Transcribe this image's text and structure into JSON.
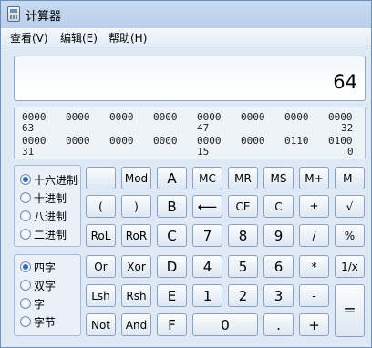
{
  "window": {
    "title": "计算器"
  },
  "menu": [
    "查看(V)",
    "编辑(E)",
    "帮助(H)"
  ],
  "display": {
    "value": "64"
  },
  "bits": {
    "row1": [
      "0000",
      "0000",
      "0000",
      "0000",
      "0000",
      "0000",
      "0000",
      "0000"
    ],
    "row1_positions": [
      "63",
      "47",
      "32"
    ],
    "row2": [
      "0000",
      "0000",
      "0000",
      "0000",
      "0000",
      "0000",
      "0110",
      "0100"
    ],
    "row2_positions": [
      "31",
      "15",
      "0"
    ]
  },
  "base_options": {
    "items": [
      "十六进制",
      "十进制",
      "八进制",
      "二进制"
    ],
    "selected": 0
  },
  "word_options": {
    "items": [
      "四字",
      "双字",
      "字",
      "字节"
    ],
    "selected": 0
  },
  "keys": {
    "mod": "Mod",
    "a": "A",
    "mc": "MC",
    "mr": "MR",
    "ms": "MS",
    "mplus": "M+",
    "mminus": "M-",
    "lparen": "(",
    "rparen": ")",
    "b": "B",
    "backspace": "⟵",
    "ce": "CE",
    "c": "C",
    "plusminus": "±",
    "sqrt": "√",
    "rol": "RoL",
    "ror": "RoR",
    "hc": "C",
    "n7": "7",
    "n8": "8",
    "n9": "9",
    "divide": "/",
    "percent": "%",
    "or": "Or",
    "xor": "Xor",
    "d": "D",
    "n4": "4",
    "n5": "5",
    "n6": "6",
    "multiply": "*",
    "reciprocal": "1/x",
    "lsh": "Lsh",
    "rsh": "Rsh",
    "e": "E",
    "n1": "1",
    "n2": "2",
    "n3": "3",
    "minus": "-",
    "equals": "=",
    "not": "Not",
    "and": "And",
    "f": "F",
    "n0": "0",
    "dot": ".",
    "plus": "+"
  }
}
